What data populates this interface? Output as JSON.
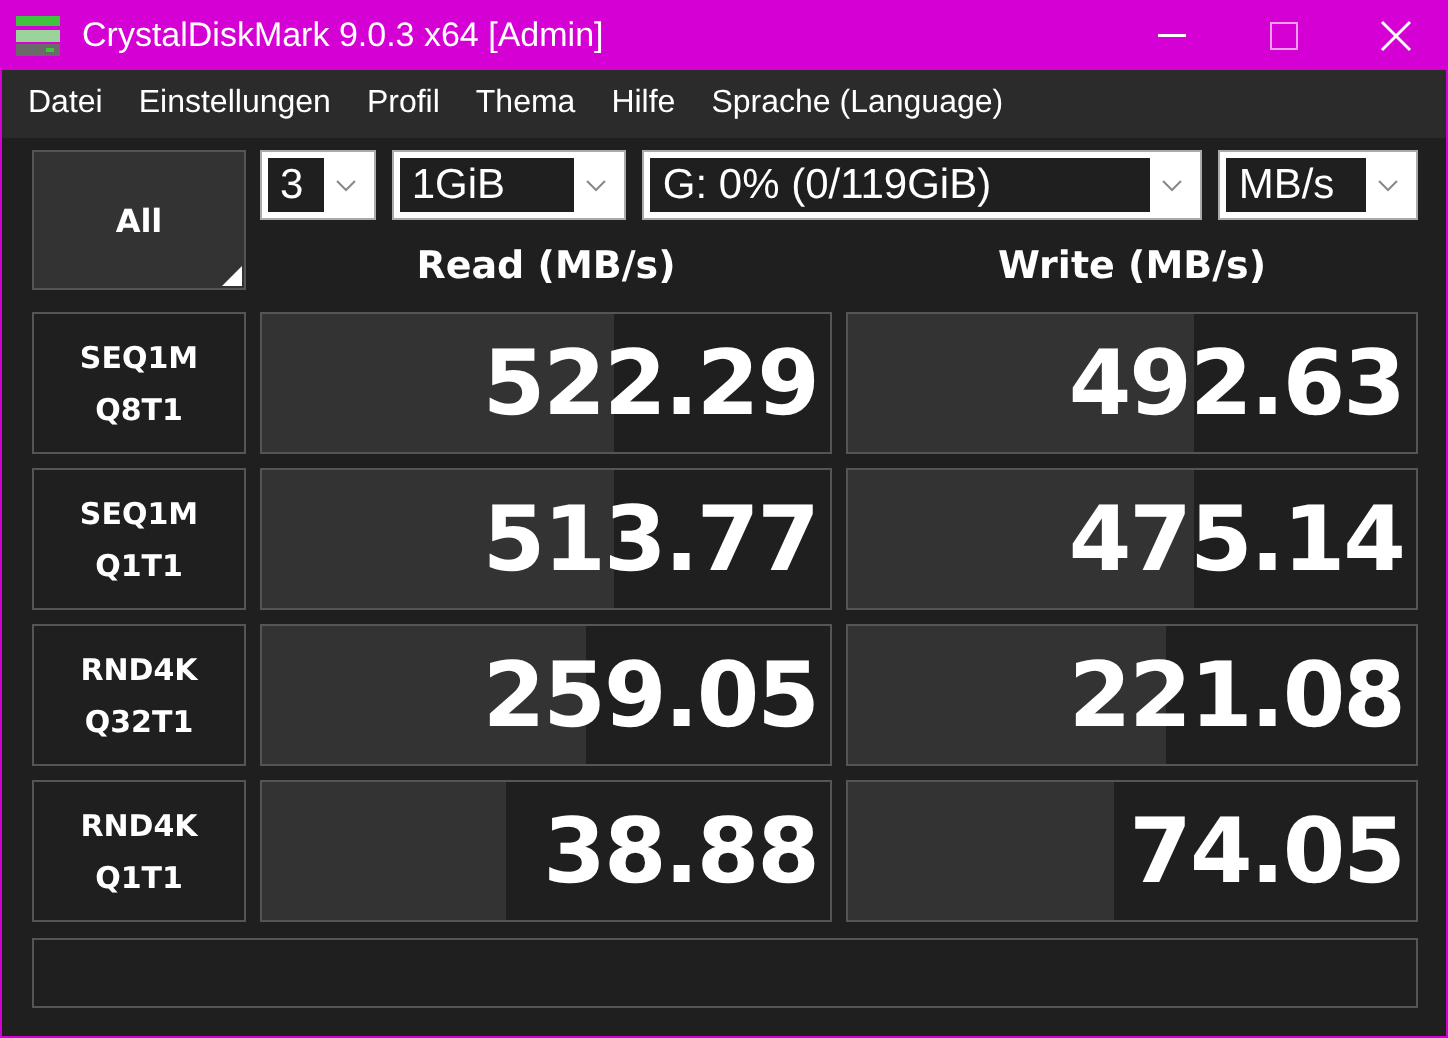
{
  "window": {
    "title": "CrystalDiskMark 9.0.3 x64 [Admin]"
  },
  "menu": [
    "Datei",
    "Einstellungen",
    "Profil",
    "Thema",
    "Hilfe",
    "Sprache (Language)"
  ],
  "all_button": {
    "label": "All"
  },
  "selects": [
    {
      "value": "3"
    },
    {
      "value": "1GiB"
    },
    {
      "value": "G: 0% (0/119GiB)"
    },
    {
      "value": "MB/s"
    }
  ],
  "columns": [
    "Read (MB/s)",
    "Write (MB/s)"
  ],
  "rows": [
    {
      "label": [
        "SEQ1M",
        "Q8T1"
      ],
      "read": {
        "value": "522.29",
        "level": 0.62
      },
      "write": {
        "value": "492.63",
        "level": 0.61
      }
    },
    {
      "label": [
        "SEQ1M",
        "Q1T1"
      ],
      "read": {
        "value": "513.77",
        "level": 0.62
      },
      "write": {
        "value": "475.14",
        "level": 0.61
      }
    },
    {
      "label": [
        "RND4K",
        "Q32T1"
      ],
      "read": {
        "value": "259.05",
        "level": 0.57
      },
      "write": {
        "value": "221.08",
        "level": 0.56
      }
    },
    {
      "label": [
        "RND4K",
        "Q1T1"
      ],
      "read": {
        "value": "38.88",
        "level": 0.43
      },
      "write": {
        "value": "74.05",
        "level": 0.47
      }
    }
  ]
}
